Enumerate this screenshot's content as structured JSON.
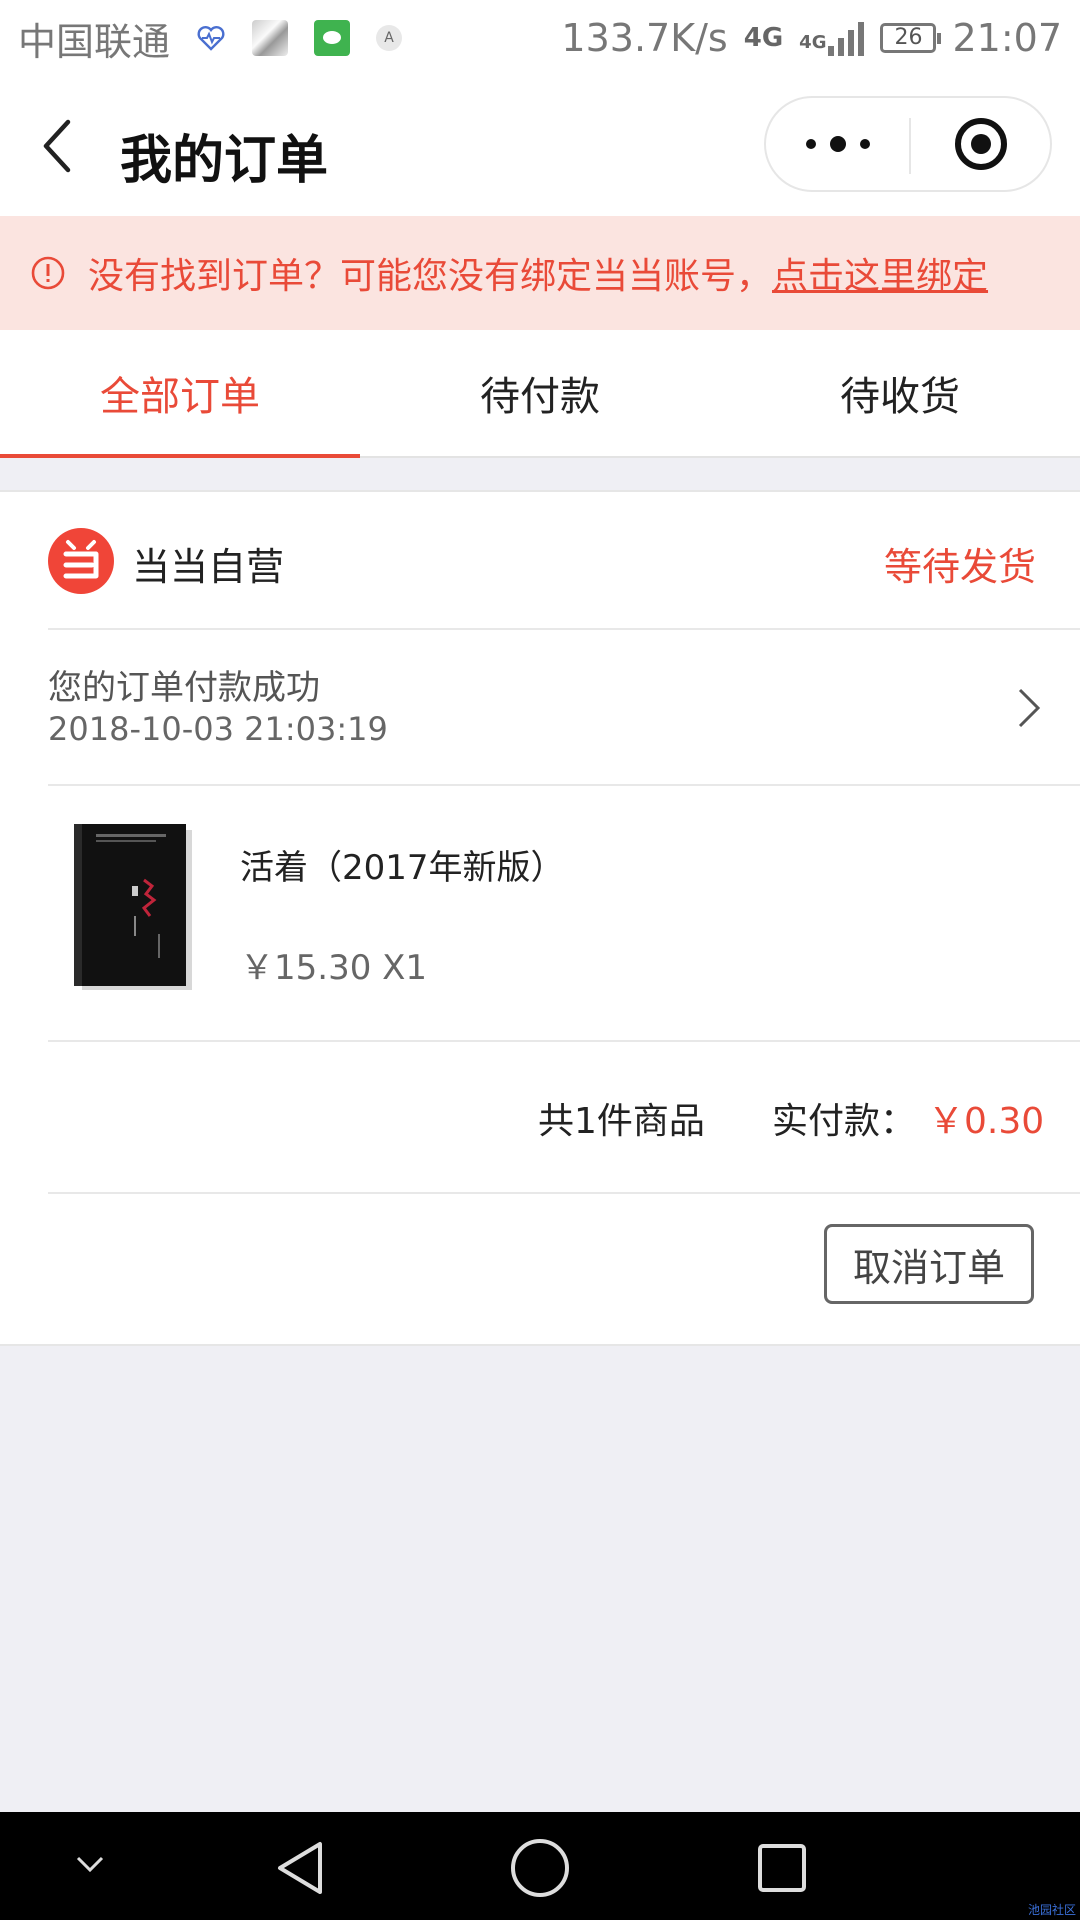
{
  "status_bar": {
    "carrier": "中国联通",
    "speed": "133.7K/s",
    "network_1": "4G",
    "network_2": "4G",
    "battery": "26",
    "time": "21:07"
  },
  "navbar": {
    "title": "我的订单"
  },
  "notice": {
    "text": "没有找到订单？可能您没有绑定当当账号，",
    "link": "点击这里绑定"
  },
  "tabs": [
    {
      "label": "全部订单",
      "active": true
    },
    {
      "label": "待付款",
      "active": false
    },
    {
      "label": "待收货",
      "active": false
    }
  ],
  "order": {
    "shop_name": "当当自营",
    "status": "等待发货",
    "message": "您的订单付款成功",
    "time": "2018-10-03 21:03:19",
    "product": {
      "name": "活着（2017年新版）",
      "price_qty": "￥15.30 X1"
    },
    "summary": {
      "count": "共1件商品",
      "paid_label": "实付款：",
      "paid_amount": "￥0.30"
    },
    "cancel_label": "取消订单"
  },
  "colors": {
    "accent": "#e94a38",
    "notice_bg": "#fbe4e0",
    "page_bg": "#efeff4"
  },
  "watermark": "池园社区"
}
